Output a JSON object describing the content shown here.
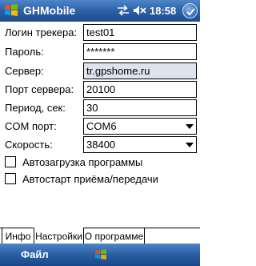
{
  "titlebar": {
    "title": "GHMobile",
    "time": "18:58"
  },
  "form": {
    "login_label": "Логин трекера:",
    "login_value": "test01",
    "password_label": "Пароль:",
    "password_value": "*******",
    "server_label": "Сервер:",
    "server_value": "tr.gpshome.ru",
    "port_label": "Порт сервера:",
    "port_value": "20100",
    "period_label": "Период, сек:",
    "period_value": "30",
    "com_label": "COM порт:",
    "com_value": "COM6",
    "speed_label": "Скорость:",
    "speed_value": "38400",
    "autoload_label": "Автозагрузка программы",
    "autoload_checked": false,
    "autostart_label": "Автостарт приёма/передачи",
    "autostart_checked": false
  },
  "tabs": [
    {
      "label": "Инфо",
      "active": false
    },
    {
      "label": "Настройки",
      "active": true
    },
    {
      "label": "О программе",
      "active": false
    }
  ],
  "menubar": {
    "file_label": "Файл"
  },
  "icons": [
    "windows-logo-icon",
    "sync-icon",
    "volume-muted-icon",
    "ok-icon",
    "keyboard-icon"
  ]
}
